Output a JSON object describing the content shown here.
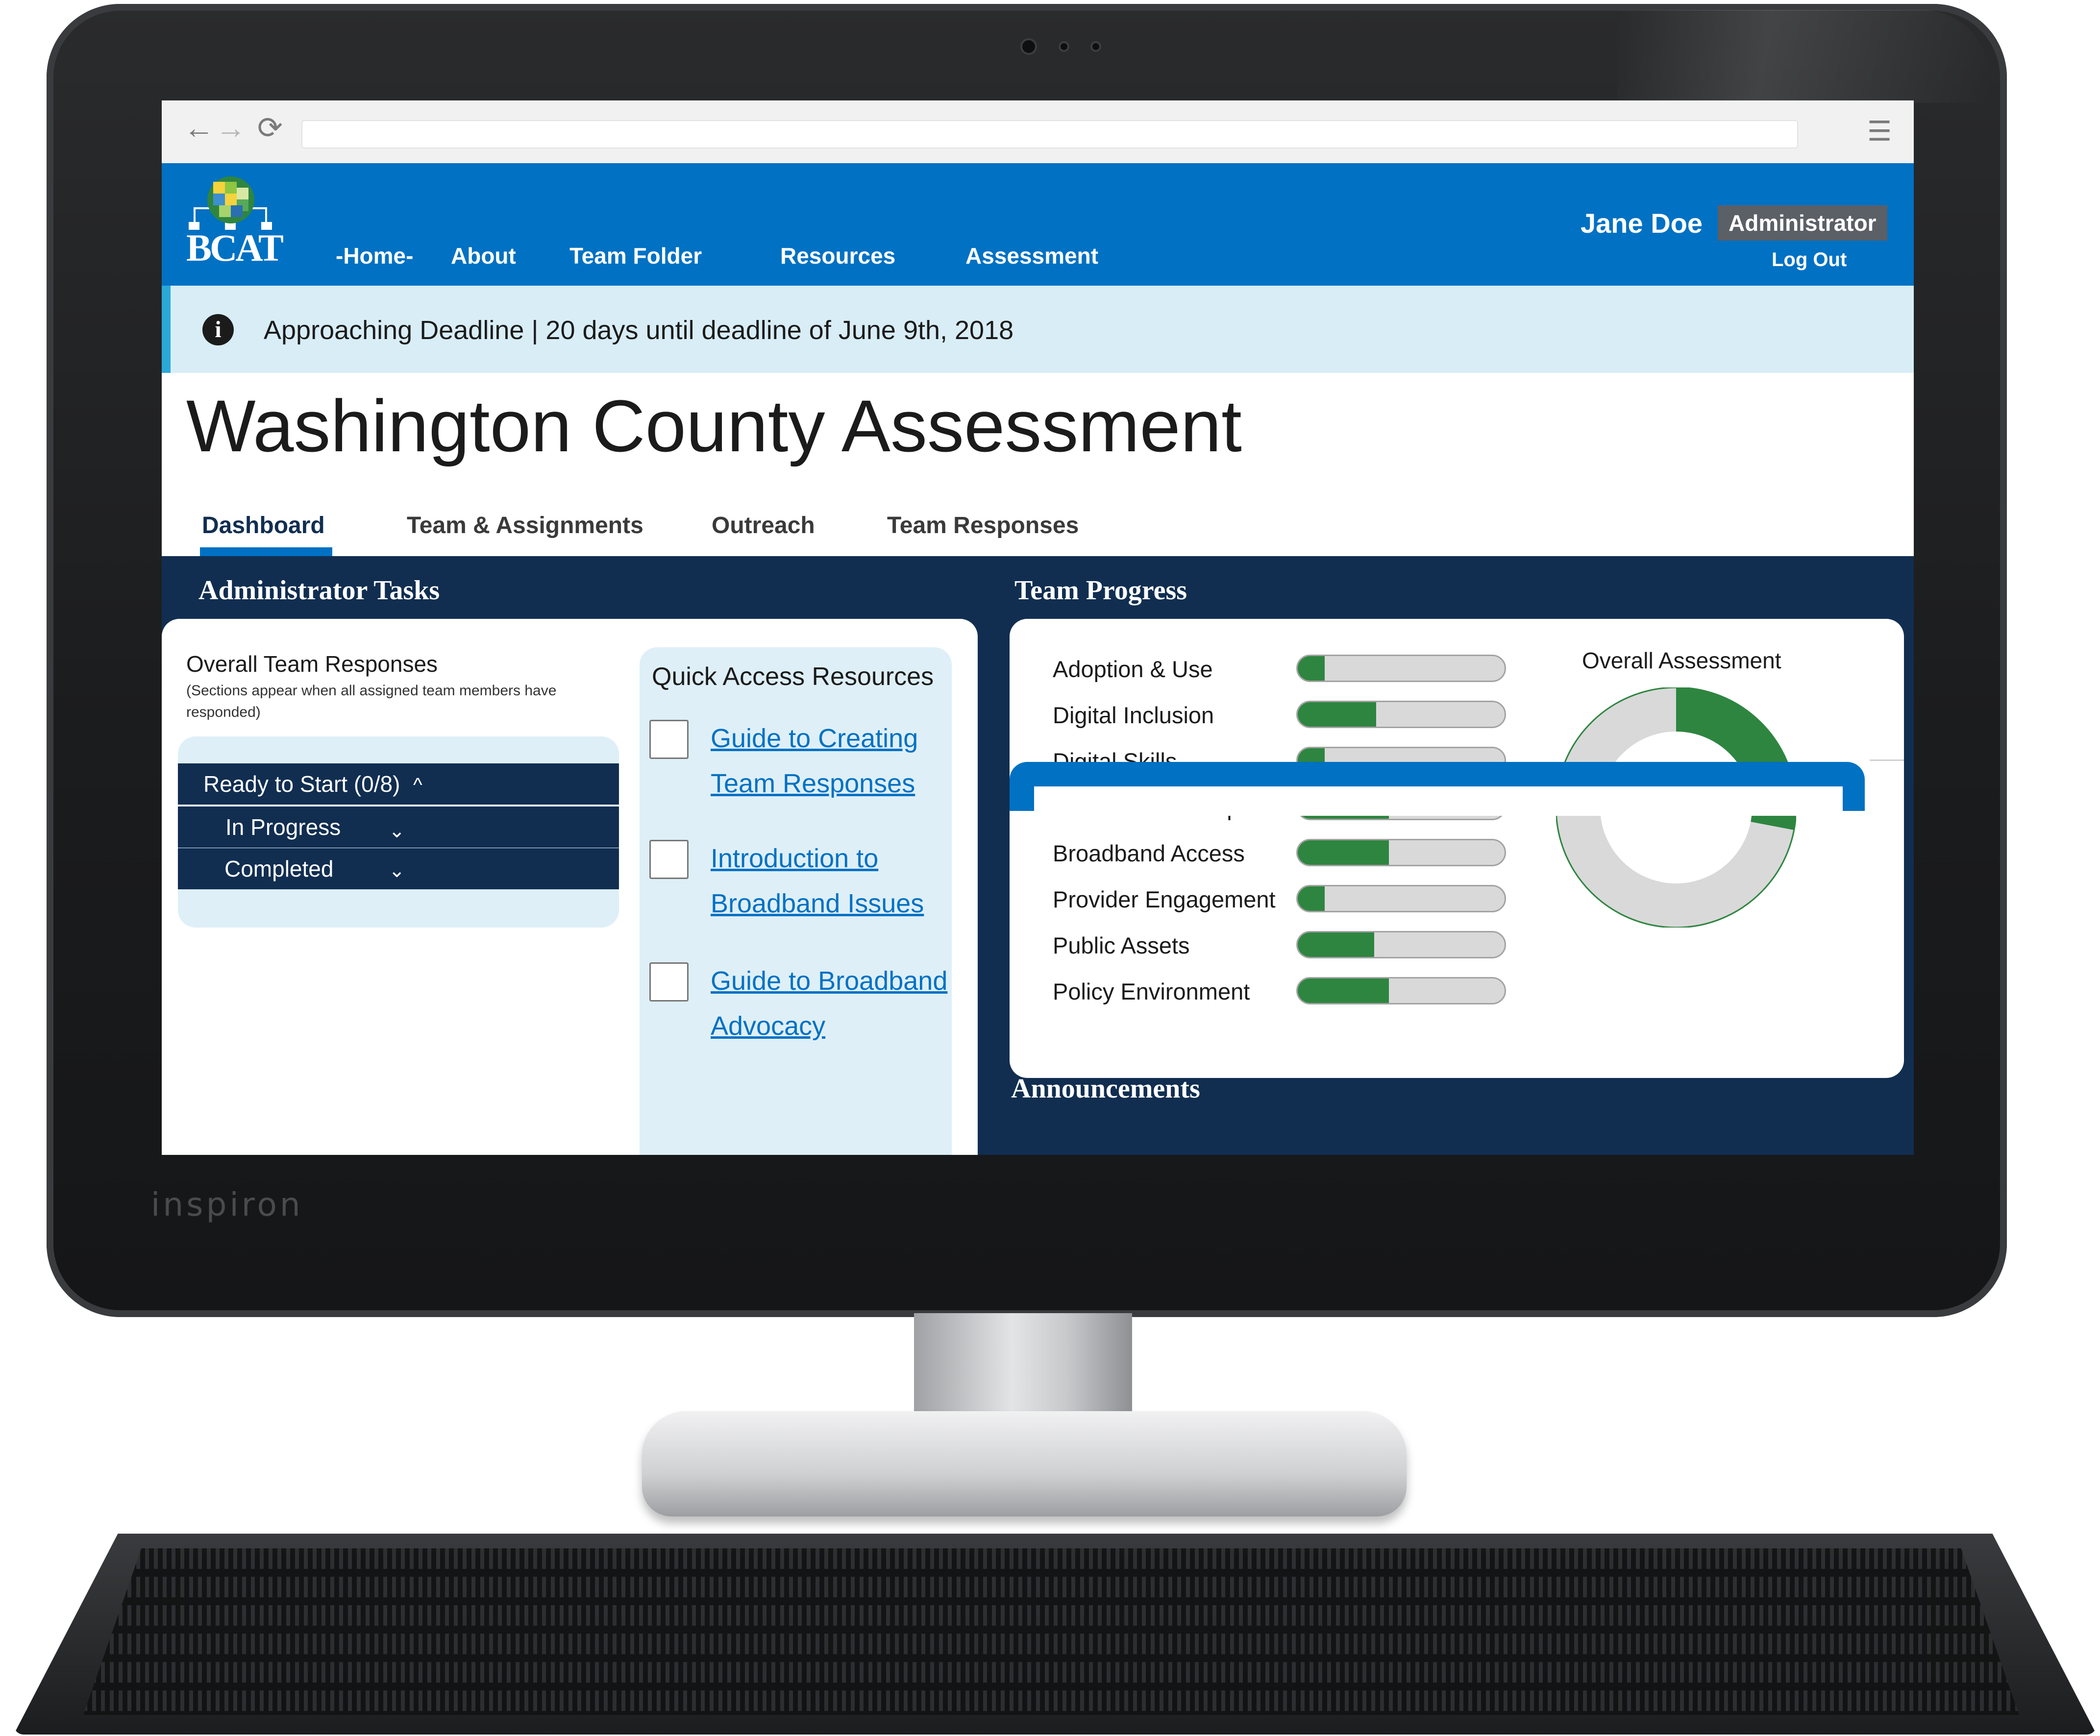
{
  "device": {
    "brand": "inspiron"
  },
  "browser": {
    "back": "←",
    "forward": "→",
    "reload": "⟳",
    "menu": "☰"
  },
  "header": {
    "logo_text": "BCAT",
    "nav": [
      "-Home-",
      "About",
      "Team Folder",
      "Resources",
      "Assessment"
    ],
    "user_name": "Jane Doe",
    "role": "Administrator",
    "logout": "Log Out"
  },
  "alert": {
    "icon": "i",
    "text": "Approaching Deadline | 20 days until deadline of June 9th, 2018"
  },
  "page_title": "Washington County Assessment",
  "tabs": [
    {
      "label": "Dashboard",
      "active": true
    },
    {
      "label": "Team & Assignments",
      "active": false
    },
    {
      "label": "Outreach",
      "active": false
    },
    {
      "label": "Team Responses",
      "active": false
    }
  ],
  "admin_tasks": {
    "heading": "Administrator Tasks",
    "overall_title": "Overall Team  Responses",
    "overall_note": "(Sections appear when all assigned team members have responded)",
    "accordion": [
      {
        "label": "Ready to Start (0/8)",
        "chevron": "^"
      },
      {
        "label": "In Progress",
        "chevron": "⌄"
      },
      {
        "label": "Completed",
        "chevron": "⌄"
      }
    ],
    "quick_access": {
      "title": "Quick Access Resources",
      "links": [
        "Guide to Creating Team Responses",
        "Introduction to Broadband Issues",
        "Guide to Broadband Advocacy"
      ]
    }
  },
  "team_progress": {
    "heading": "Team Progress",
    "accent_color": "#2e8540",
    "items": [
      {
        "label": "Adoption & Use",
        "fraction": 0.13
      },
      {
        "label": "Digital Inclusion",
        "fraction": 0.38
      },
      {
        "label": "Digital Skills",
        "fraction": 0.13
      },
      {
        "label": "Device Ownership",
        "fraction": 0.44
      },
      {
        "label": "Broadband Access",
        "fraction": 0.44
      },
      {
        "label": "Provider Engagement",
        "fraction": 0.13
      },
      {
        "label": "Public Assets",
        "fraction": 0.37
      },
      {
        "label": "Policy Environment",
        "fraction": 0.44
      }
    ],
    "overall_title": "Overall Assessment",
    "overall_fraction": 0.28
  },
  "announcements": {
    "heading": "Announcements"
  }
}
